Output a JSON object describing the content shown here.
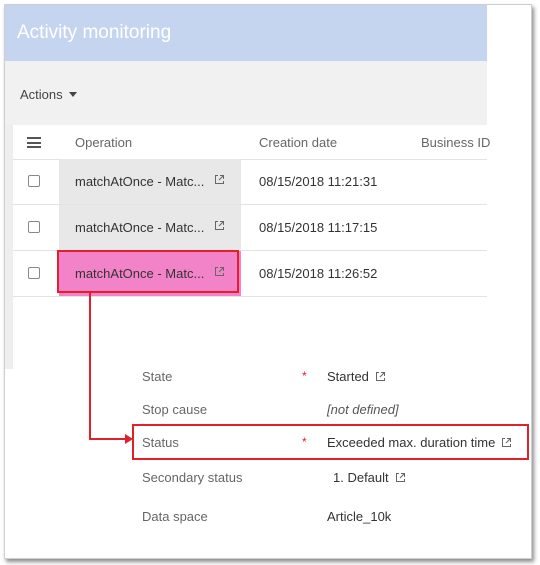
{
  "header": {
    "title": "Activity monitoring"
  },
  "toolbar": {
    "actions_label": "Actions",
    "actions_icon": "caret-down-icon"
  },
  "table": {
    "columns": [
      "Operation",
      "Creation date",
      "Business ID"
    ],
    "rows": [
      {
        "operation": "matchAtOnce - Matc...",
        "date": "08/15/2018 11:21:31"
      },
      {
        "operation": "matchAtOnce - Matc...",
        "date": "08/15/2018 11:17:15"
      },
      {
        "operation": "matchAtOnce - Matc...",
        "date": "08/15/2018 11:26:52"
      }
    ]
  },
  "details": {
    "state": {
      "label": "State",
      "required": "*",
      "value": "Started"
    },
    "stop_cause": {
      "label": "Stop cause",
      "value": "[not defined]"
    },
    "status": {
      "label": "Status",
      "required": "*",
      "value": "Exceeded max. duration time"
    },
    "secondary_status": {
      "label": "Secondary status",
      "value": "1. Default"
    },
    "data_space": {
      "label": "Data space",
      "value": "Article_10k"
    }
  },
  "colors": {
    "title_bar": "#c6d5ef",
    "highlight_cell": "#f383c8",
    "annotation_red": "#e0202a"
  }
}
